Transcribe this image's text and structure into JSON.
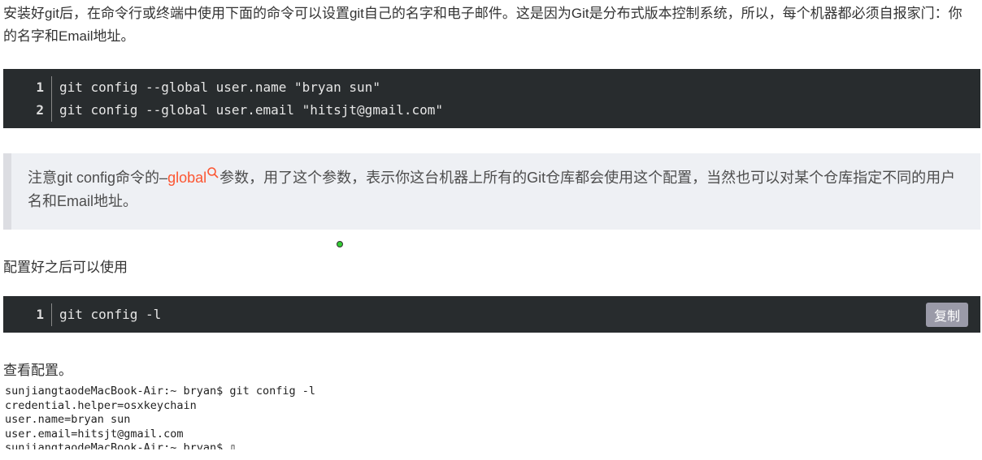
{
  "intro": "安装好git后，在命令行或终端中使用下面的命令可以设置git自己的名字和电子邮件。这是因为Git是分布式版本控制系统，所以，每个机器都必须自报家门：你的名字和Email地址。",
  "code1": [
    {
      "n": "1",
      "t": "git config --global user.name \"bryan sun\""
    },
    {
      "n": "2",
      "t": "git config --global user.email \"hitsjt@gmail.com\""
    }
  ],
  "note": {
    "before": "注意git config命令的–",
    "link": "global",
    "after": "参数，用了这个参数，表示你这台机器上所有的Git仓库都会使用这个配置，当然也可以对某个仓库指定不同的用户名和Email地址。"
  },
  "after_config": "配置好之后可以使用",
  "code2": [
    {
      "n": "1",
      "t": "git config -l"
    }
  ],
  "copy_label": "复制",
  "view_config": "查看配置。",
  "terminal": [
    "sunjiangtaodeMacBook-Air:~ bryan$ git config -l",
    "credential.helper=osxkeychain",
    "user.name=bryan sun",
    "user.email=hitsjt@gmail.com",
    "sunjiangtaodeMacBook-Air:~ bryan$ ▯"
  ]
}
